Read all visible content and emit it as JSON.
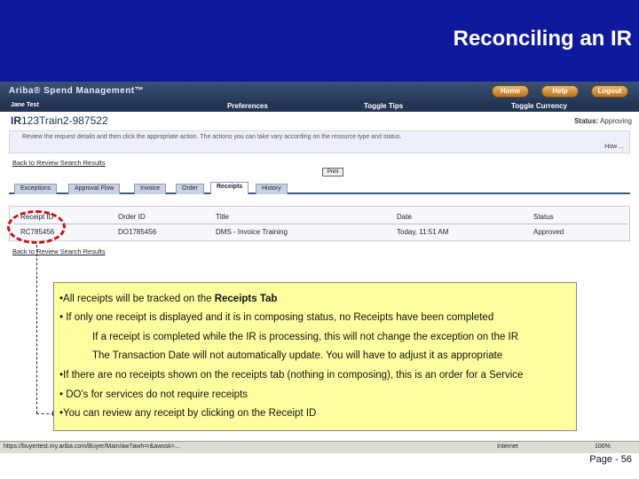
{
  "slide": {
    "title": "Reconciling an IR",
    "page_number": "Page - 56"
  },
  "app": {
    "logo": "Ariba® Spend Management™",
    "buttons": [
      "Home",
      "Help",
      "Logout"
    ],
    "user": "Jane Test",
    "links": [
      "Preferences",
      "Toggle Tips",
      "Toggle Currency"
    ]
  },
  "ir": {
    "prefix": "IR",
    "id": "123Train2-987522",
    "status_label": "Status:",
    "status_value": "Approving",
    "instructions": "Review the request details and then click the appropriate action. The actions you can take vary according on the resource type and status.",
    "how": "How ...",
    "back_link": "Back to Review Search Results",
    "print_label": "Print",
    "back_link_bottom": "Back to Review Search Results"
  },
  "tabs": [
    {
      "label": "Exceptions",
      "active": false
    },
    {
      "label": "Approval Flow",
      "active": false
    },
    {
      "label": "Invoice",
      "active": false
    },
    {
      "label": "Order",
      "active": false
    },
    {
      "label": "Receipts",
      "active": true
    },
    {
      "label": "History",
      "active": false
    }
  ],
  "receipts_table": {
    "columns": [
      "Receipt ID",
      "Order ID",
      "Title",
      "Date",
      "Status"
    ],
    "rows": [
      [
        "RC785456",
        "DO1785456",
        "DMS - Invoice Training",
        "Today, 11:51 AM",
        "Approved"
      ]
    ]
  },
  "note": {
    "lines": [
      {
        "prefix": "•All receipts will be tracked on the ",
        "bold": "Receipts Tab",
        "suffix": ""
      },
      {
        "prefix": "• If only one receipt is displayed and it is in composing status, no Receipts have been completed",
        "bold": "",
        "suffix": ""
      },
      {
        "prefix": "If a receipt is completed while the IR is processing, this will not change the exception on the IR",
        "bold": "",
        "suffix": ""
      },
      {
        "prefix": "The Transaction Date will not automatically update.  You will have to adjust it as appropriate",
        "bold": "",
        "suffix": ""
      },
      {
        "prefix": "•If there are no receipts shown on the receipts tab (nothing in composing), this is an order for a Service",
        "bold": "",
        "suffix": ""
      },
      {
        "prefix": "• DO's for services do not require receipts",
        "bold": "",
        "suffix": ""
      },
      {
        "prefix": "•You can review any receipt by clicking on the Receipt ID",
        "bold": "",
        "suffix": ""
      }
    ]
  },
  "statusbar": {
    "url": "https://buyertest.my.ariba.com/Buyer/Main/aw?awh=r&awssk=...",
    "zone": "Internet",
    "zoom": "100%"
  },
  "colors": {
    "banner": "#0e1a9b",
    "note_bg": "#ffffa0",
    "highlight_circle": "#cc1111"
  }
}
